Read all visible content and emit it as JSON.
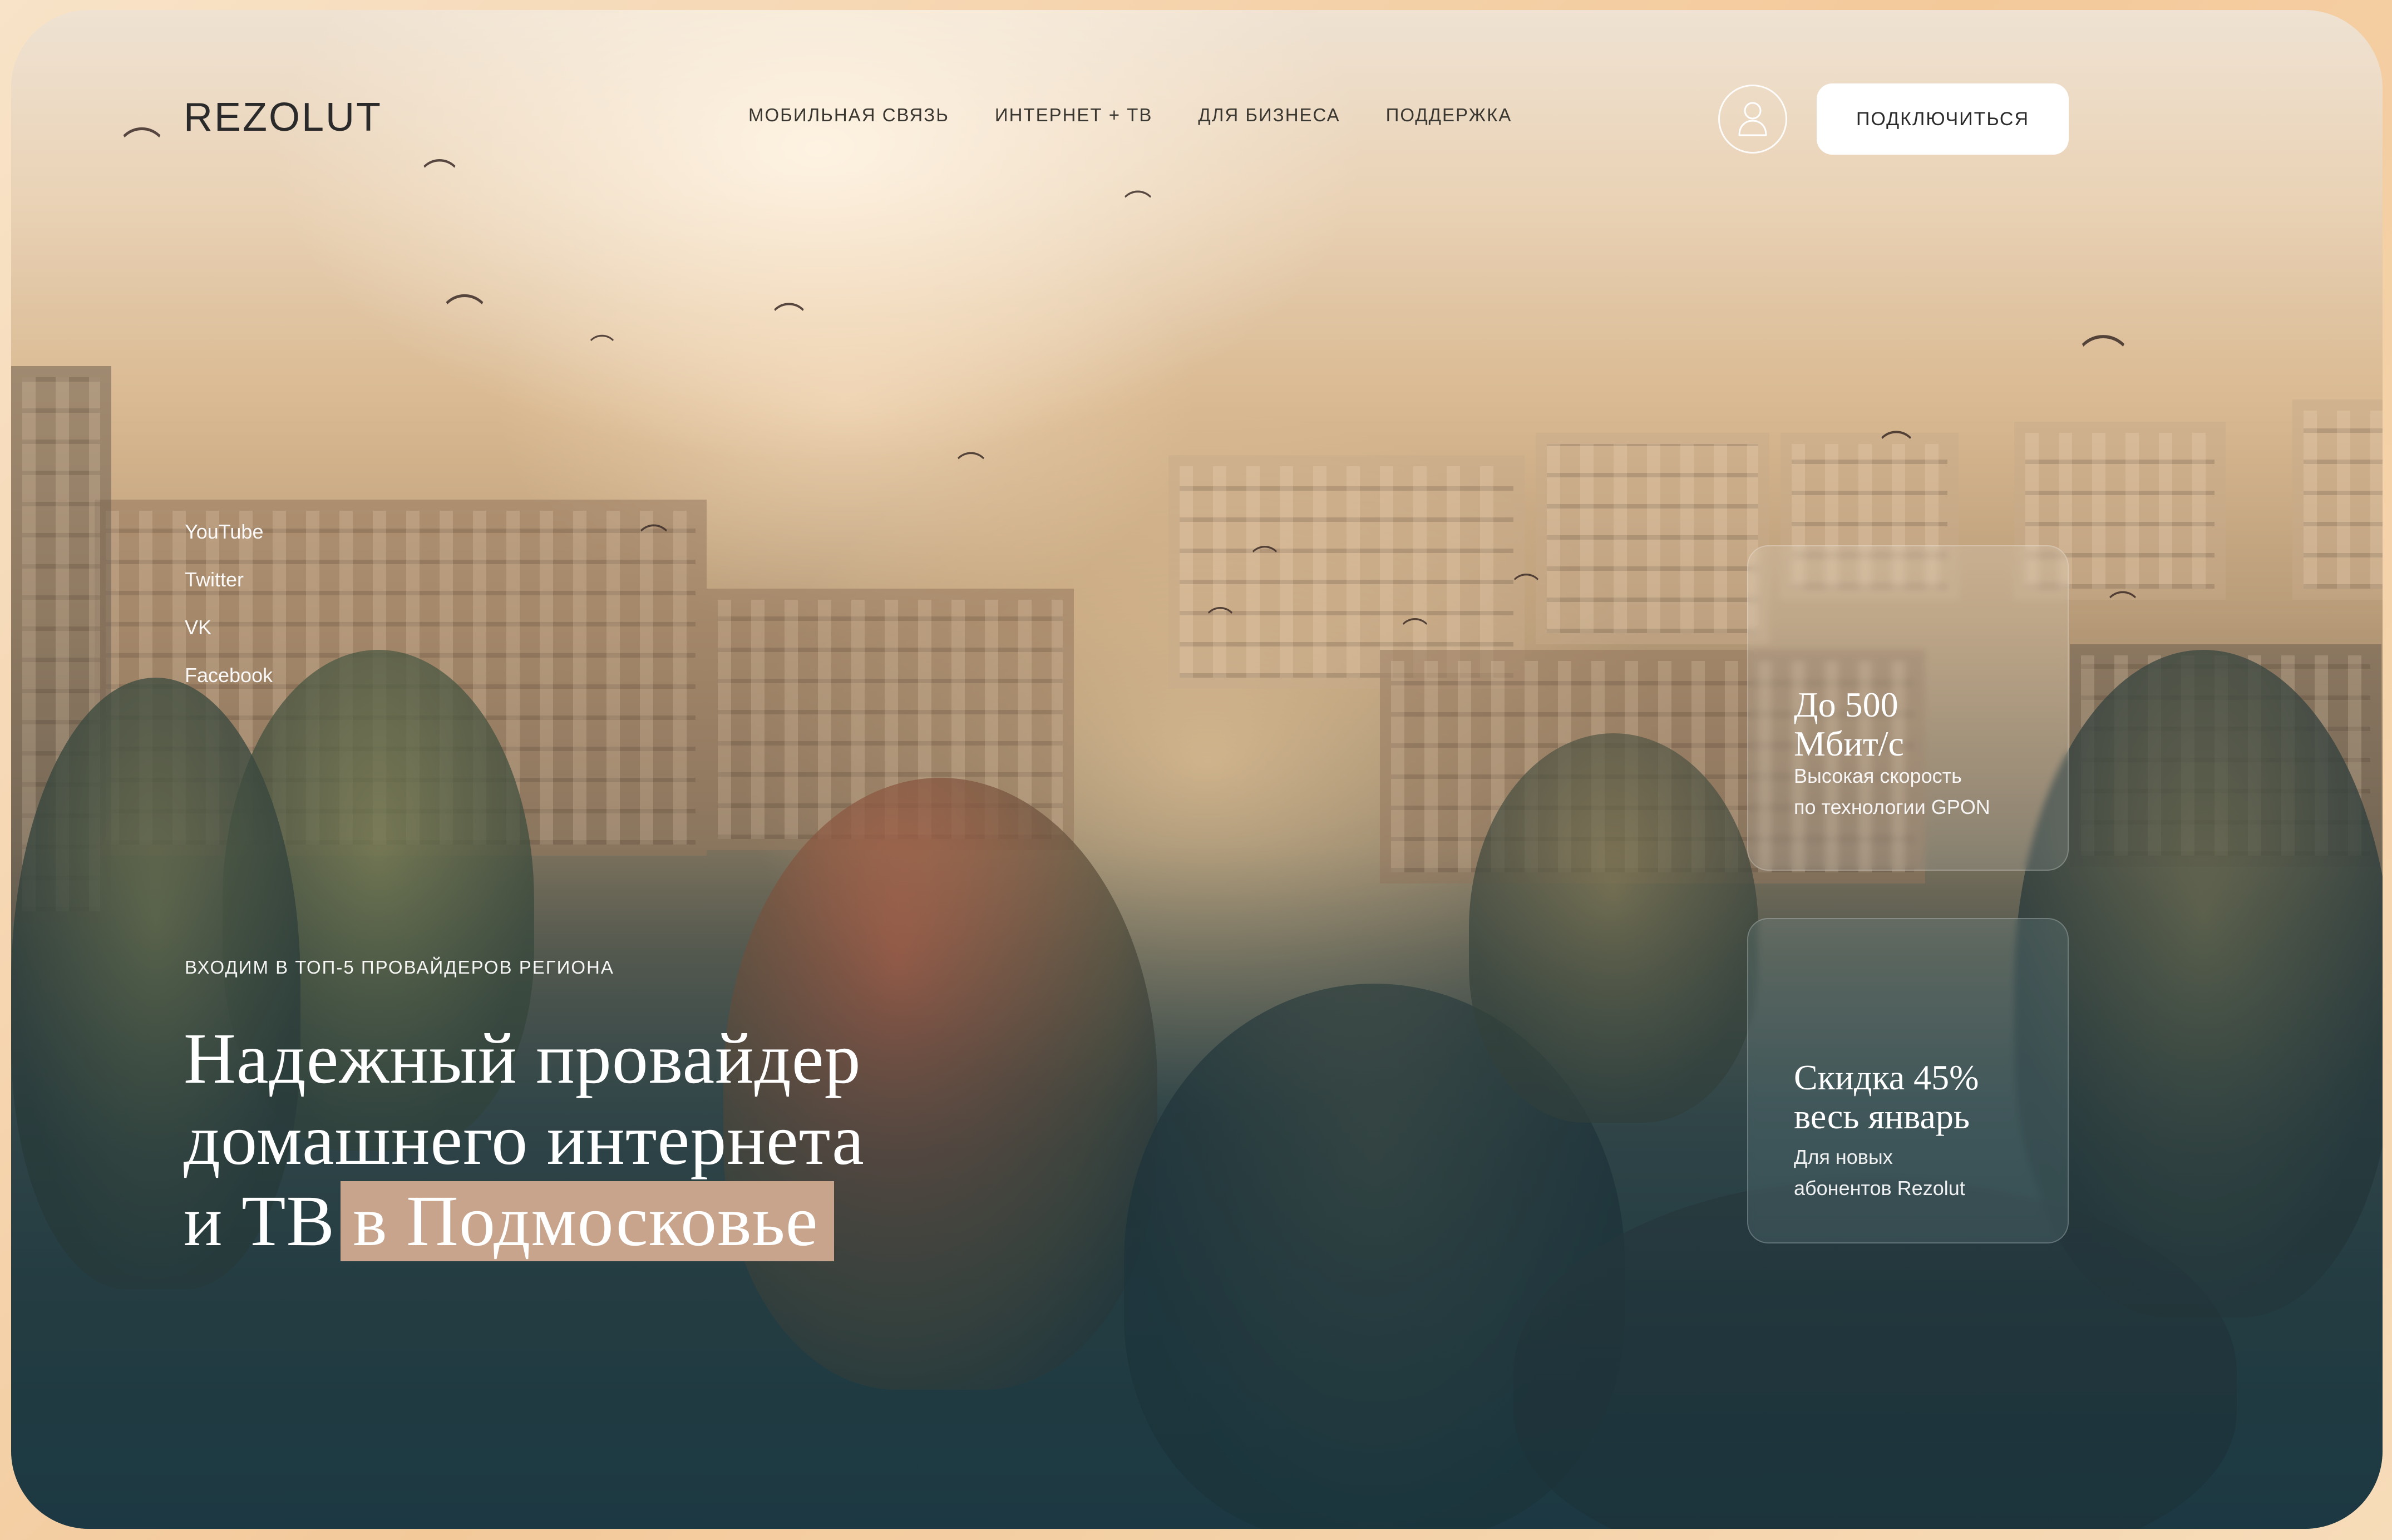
{
  "header": {
    "logo": "REZOLUT",
    "nav": [
      {
        "label": "МОБИЛЬНАЯ СВЯЗЬ"
      },
      {
        "label": "ИНТЕРНЕТ + ТВ"
      },
      {
        "label": "ДЛЯ БИЗНЕСА"
      },
      {
        "label": "ПОДДЕРЖКА"
      }
    ],
    "profile_icon": "user-icon",
    "cta_label": "ПОДКЛЮЧИТЬСЯ"
  },
  "socials": [
    {
      "label": "YouTube"
    },
    {
      "label": "Twitter"
    },
    {
      "label": "VK"
    },
    {
      "label": "Facebook"
    }
  ],
  "hero": {
    "eyebrow": "ВХОДИМ В ТОП-5 ПРОВАЙДЕРОВ РЕГИОНА",
    "headline_line1": "Надежный провайдер",
    "headline_line2": "домашнего интернета",
    "headline_line3_plain": "и ТВ",
    "headline_line3_highlight": "в Подмосковье"
  },
  "cards": [
    {
      "title_line1": "До 500",
      "title_line2": "Мбит/с",
      "desc_line1": "Высокая скорость",
      "desc_line2": "по технологии GPON"
    },
    {
      "title_line1": "Скидка 45%",
      "title_line2": "весь январь",
      "desc_line1": "Для новых",
      "desc_line2": "абонентов Rezolut"
    }
  ],
  "colors": {
    "frame": "#f3c99a",
    "highlight": "#c9a48c",
    "cta_bg": "#ffffff",
    "text_dark": "#2a2a2a",
    "text_light": "#ffffff"
  }
}
